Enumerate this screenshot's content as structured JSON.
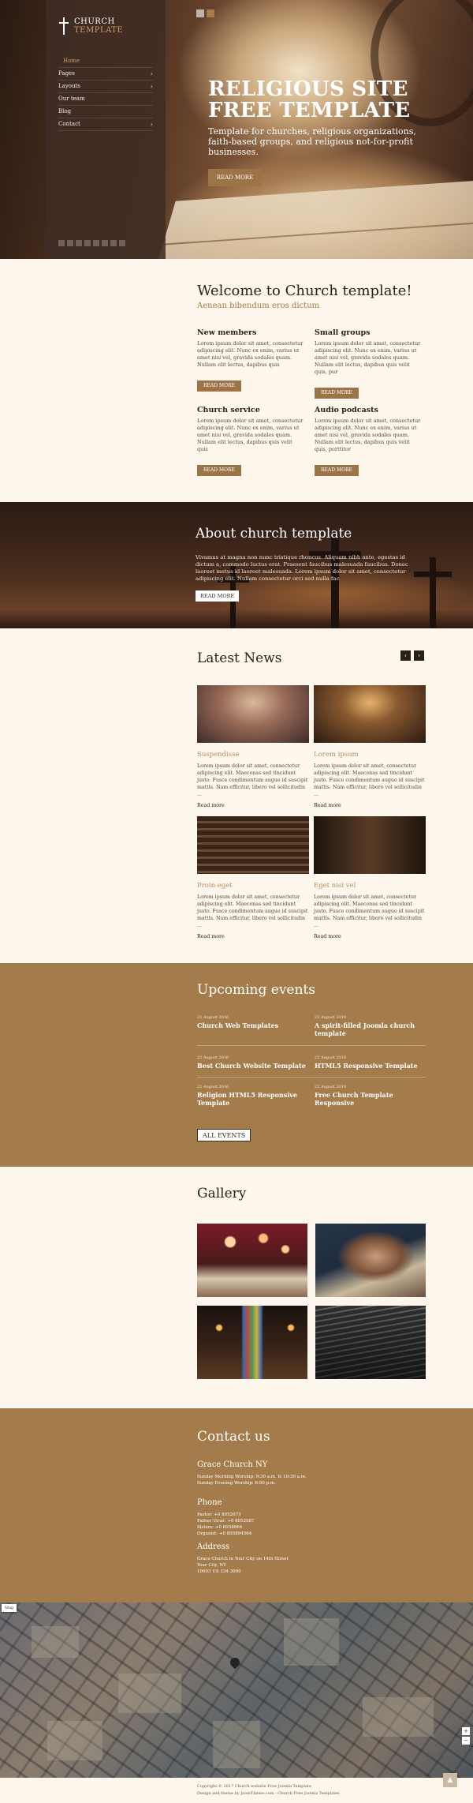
{
  "logo": {
    "line1": "CHURCH",
    "line2": "TEMPLATE"
  },
  "nav": [
    {
      "label": "Home",
      "submenu": false
    },
    {
      "label": "Pages",
      "submenu": true
    },
    {
      "label": "Layouts",
      "submenu": true
    },
    {
      "label": "Our team",
      "submenu": false
    },
    {
      "label": "Blog",
      "submenu": false
    },
    {
      "label": "Contact",
      "submenu": true
    }
  ],
  "hero": {
    "title": "RELIGIOUS SITE FREE TEMPLATE",
    "subtitle": "Template for churches, religious organizations, faith-based groups, and religious not-for-profit businesses.",
    "button": "READ MORE"
  },
  "welcome": {
    "title": "Welcome to Church template!",
    "subtitle": "Aenean bibendum eros dictum",
    "features": [
      {
        "title": "New members",
        "text": "Lorem ipsum dolor sit amet, consectetur adipiscing elit. Nunc ex enim, varius ut amet nisi vel, gravida sodales quam. Nullam elit lectus, dapibus quis",
        "button": "READ MORE"
      },
      {
        "title": "Small groups",
        "text": "Lorem ipsum dolor sit amet, consectetur adipiscing elit. Nunc ex enim, varius ut amet nisi vel, gravida sodales quam. Nullam elit lectus, dapibus quis velit quis, pur",
        "button": "READ MORE"
      },
      {
        "title": "Church service",
        "text": "Lorem ipsum dolor sit amet, consectetur adipiscing elit. Nunc ex enim, varius ut amet nisi vel, gravida sodales quam. Nullam elit lectus, dapibus quis velit quis",
        "button": "READ MORE"
      },
      {
        "title": "Audio podcasts",
        "text": "Lorem ipsum dolor sit amet, consectetur adipiscing elit. Nunc ex enim, varius ut amet nisi vel, gravida sodales quam. Nullam elit lectus, dapibus quis velit quis, porttitor",
        "button": "READ MORE"
      }
    ]
  },
  "about": {
    "title": "About church template",
    "text": "Vivamus at magna non nunc tristique rhoncus. Aliquam nibh ante, egestas id dictum a, commodo luctus erat. Praesent faucibus malesuada faucibus. Donec laoreet metus id laoreet malesuada. Lorem ipsum dolor sit amet, consectetur adipiscing elit. Nullam consectetur orci sed nulla fac",
    "button": "READ MORE"
  },
  "news": {
    "title": "Latest News",
    "prev": "‹",
    "next": "›",
    "items": [
      {
        "title": "Suspendisse",
        "text": "Lorem ipsum dolor sit amet, consectetur adipiscing elit. Maecenas sed tincidunt justo. Fusce condimentum augue id suscipit mattis. Nam efficitur, libero vel sollicitudin ...",
        "more": "Read more"
      },
      {
        "title": "Lorem ipsum",
        "text": "Lorem ipsum dolor sit amet, consectetur adipiscing elit. Maecenas sed tincidunt justo. Fusce condimentum augue id suscipit mattis. Nam efficitur, libero vel sollicitudin ...",
        "more": "Read more"
      },
      {
        "title": "Proin eget",
        "text": "Lorem ipsum dolor sit amet, consectetur adipiscing elit. Maecenas sed tincidunt justo. Fusce condimentum augue id suscipit mattis. Nam efficitur, libero vel sollicitudin ...",
        "more": "Read more"
      },
      {
        "title": "Eget nisi vel",
        "text": "Lorem ipsum dolor sit amet, consectetur adipiscing elit. Maecenas sed tincidunt justo. Fusce condimentum augue id suscipit mattis. Nam efficitur, libero vel sollicitudin ...",
        "more": "Read more"
      }
    ]
  },
  "events": {
    "title": "Upcoming events",
    "items": [
      {
        "date": "22 August 2016",
        "title": "Church Web Templates"
      },
      {
        "date": "22 August 2016",
        "title": "A spirit-filled Joomla church template"
      },
      {
        "date": "22 August 2016",
        "title": "Best Church Website Template"
      },
      {
        "date": "22 August 2016",
        "title": "HTML5 Responsive Template"
      },
      {
        "date": "22 August 2016",
        "title": "Religion HTML5 Responsive Template"
      },
      {
        "date": "22 August 2016",
        "title": "Free Church Template Responsive"
      }
    ],
    "button": "ALL EVENTS"
  },
  "gallery": {
    "title": "Gallery"
  },
  "contact": {
    "title": "Contact us",
    "church": {
      "title": "Grace Church NY",
      "lines": [
        "Sunday Morning Worship: 9:30 a.m. & 10:30 a.m.",
        "Sunday Evening Worship: 6:00 p.m."
      ]
    },
    "phone": {
      "title": "Phone",
      "lines": [
        "Pastor: +0 8052075",
        "Father Vicar: +0 8052087",
        "Sisters: +0 8058964",
        "Organist: +0 805894564"
      ]
    },
    "address": {
      "title": "Address",
      "lines": [
        "Grace Church in Your City on 14th Street",
        "Your City, NY",
        "10003 US 334 3000"
      ]
    }
  },
  "map": {
    "label": "Map",
    "zoom_in": "+",
    "zoom_out": "−"
  },
  "footer": {
    "line1": "Copyright © 2017 Church website Free Joomla Template",
    "line2": "Design and theme by JoomTheme.com - Church Free Joomla Templates"
  },
  "to_top": "▲",
  "colors": {
    "accent": "#a47c4c",
    "dark": "#2e2018",
    "cream": "#fdf6ec"
  }
}
